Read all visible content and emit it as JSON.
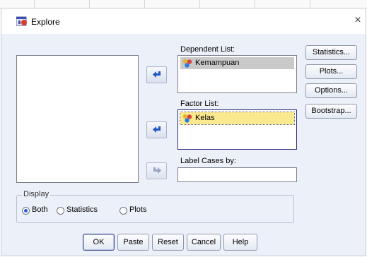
{
  "dialog": {
    "title": "Explore",
    "close_glyph": "×",
    "icon": "spss-app-icon"
  },
  "dependent_list": {
    "label": "Dependent List:",
    "items": [
      {
        "label": "Kemampuan",
        "icon": "scale-variable-icon",
        "selected": true
      }
    ]
  },
  "factor_list": {
    "label": "Factor List:",
    "items": [
      {
        "label": "Kelas",
        "icon": "nominal-variable-icon",
        "selected": true
      }
    ]
  },
  "label_cases": {
    "label": "Label Cases by:",
    "value": ""
  },
  "side_buttons": [
    {
      "label": "Statistics..."
    },
    {
      "label": "Plots..."
    },
    {
      "label": "Options..."
    },
    {
      "label": "Bootstrap..."
    }
  ],
  "display": {
    "legend": "Display",
    "options": [
      {
        "label": "Both",
        "selected": true
      },
      {
        "label": "Statistics",
        "selected": false
      },
      {
        "label": "Plots",
        "selected": false
      }
    ]
  },
  "bottom_buttons": [
    {
      "label": "OK"
    },
    {
      "label": "Paste"
    },
    {
      "label": "Reset"
    },
    {
      "label": "Cancel"
    },
    {
      "label": "Help"
    }
  ],
  "colors": {
    "dialog_bg": "#ecf0f9",
    "selected_gray": "#c9c9c9",
    "selected_yellow": "#fbe98f",
    "arrow_blue": "#1f56c6",
    "arrow_disabled": "#8a97b5"
  }
}
